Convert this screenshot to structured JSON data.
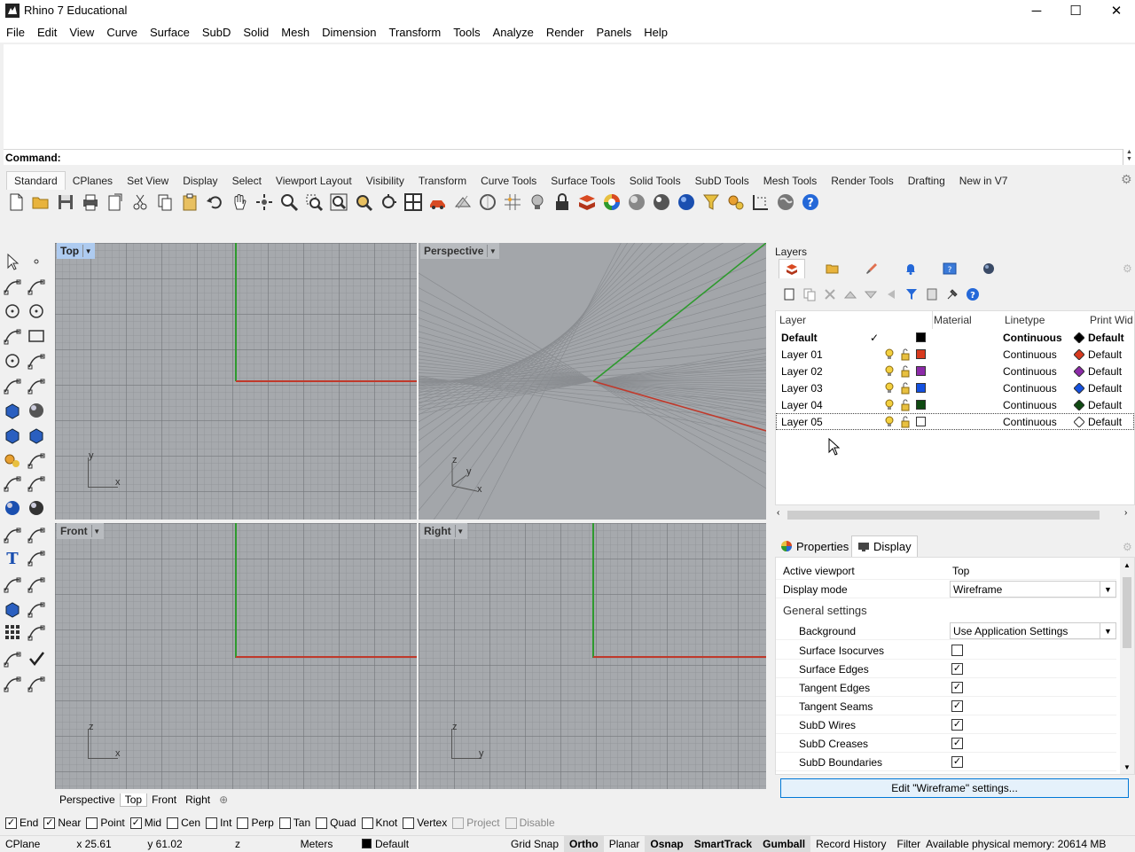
{
  "window": {
    "title": "Rhino 7 Educational",
    "minimize": "─",
    "maximize": "☐",
    "close": "✕"
  },
  "menu": [
    "File",
    "Edit",
    "View",
    "Curve",
    "Surface",
    "SubD",
    "Solid",
    "Mesh",
    "Dimension",
    "Transform",
    "Tools",
    "Analyze",
    "Render",
    "Panels",
    "Help"
  ],
  "command": {
    "label": "Command:",
    "value": ""
  },
  "toolbar_tabs": [
    "Standard",
    "CPlanes",
    "Set View",
    "Display",
    "Select",
    "Viewport Layout",
    "Visibility",
    "Transform",
    "Curve Tools",
    "Surface Tools",
    "Solid Tools",
    "SubD Tools",
    "Mesh Tools",
    "Render Tools",
    "Drafting",
    "New in V7"
  ],
  "toolbar_icons": [
    "new-icon",
    "open-icon",
    "save-icon",
    "print-icon",
    "import-icon",
    "cut-icon",
    "copy-icon",
    "paste-icon",
    "undo-icon",
    "pan-icon",
    "rotate-view-icon",
    "zoom-icon",
    "zoom-window-icon",
    "zoom-extents-icon",
    "zoom-selected-icon",
    "rotate-icon",
    "four-viewports-icon",
    "car-icon",
    "snap-icon",
    "circle-icon",
    "grid-icon",
    "light-icon",
    "lock-icon",
    "layer-icon",
    "color-wheel-icon",
    "shaded-sphere-icon",
    "rendered-sphere-icon",
    "blue-sphere-icon",
    "filter-icon",
    "settings-gears-icon",
    "dimension-icon",
    "earth-icon",
    "help-icon"
  ],
  "viewports": {
    "top": {
      "title": "Top",
      "x": "x",
      "y": "y"
    },
    "perspective": {
      "title": "Perspective",
      "x": "x",
      "y": "y",
      "z": "z"
    },
    "front": {
      "title": "Front",
      "x": "x",
      "z": "z"
    },
    "right": {
      "title": "Right",
      "y": "y",
      "z": "z"
    }
  },
  "viewport_tabs": [
    "Perspective",
    "Top",
    "Front",
    "Right"
  ],
  "viewport_tab_add": "⊕",
  "osnaps": [
    {
      "label": "End",
      "checked": true
    },
    {
      "label": "Near",
      "checked": true
    },
    {
      "label": "Point",
      "checked": false
    },
    {
      "label": "Mid",
      "checked": true
    },
    {
      "label": "Cen",
      "checked": false
    },
    {
      "label": "Int",
      "checked": false
    },
    {
      "label": "Perp",
      "checked": false
    },
    {
      "label": "Tan",
      "checked": false
    },
    {
      "label": "Quad",
      "checked": false
    },
    {
      "label": "Knot",
      "checked": false
    },
    {
      "label": "Vertex",
      "checked": false
    },
    {
      "label": "Project",
      "checked": false
    },
    {
      "label": "Disable",
      "checked": false
    }
  ],
  "status": {
    "cplane": "CPlane",
    "x": "x 25.61",
    "y": "y 61.02",
    "z": "z",
    "units": "Meters",
    "layer": "Default",
    "grid_snap": "Grid Snap",
    "ortho": "Ortho",
    "planar": "Planar",
    "osnap": "Osnap",
    "smarttrack": "SmartTrack",
    "gumball": "Gumball",
    "record_history": "Record History",
    "filter": "Filter",
    "memory": "Available physical memory: 20614 MB"
  },
  "layers": {
    "title": "Layers",
    "columns": {
      "layer": "Layer",
      "material": "Material",
      "linetype": "Linetype",
      "print_width": "Print Wid"
    },
    "rows": [
      {
        "name": "Default",
        "current": true,
        "check": "✓",
        "color": "#000000",
        "linetype": "Continuous",
        "print_color": "#000000",
        "print_width": "Default"
      },
      {
        "name": "Layer 01",
        "current": false,
        "check": "",
        "color": "#d83a1e",
        "linetype": "Continuous",
        "print_color": "#d83a1e",
        "print_width": "Default"
      },
      {
        "name": "Layer 02",
        "current": false,
        "check": "",
        "color": "#8c2aa8",
        "linetype": "Continuous",
        "print_color": "#8c2aa8",
        "print_width": "Default"
      },
      {
        "name": "Layer 03",
        "current": false,
        "check": "",
        "color": "#1451e0",
        "linetype": "Continuous",
        "print_color": "#1451e0",
        "print_width": "Default"
      },
      {
        "name": "Layer 04",
        "current": false,
        "check": "",
        "color": "#0f4a12",
        "linetype": "Continuous",
        "print_color": "#0f4a12",
        "print_width": "Default"
      },
      {
        "name": "Layer 05",
        "current": false,
        "check": "",
        "color": "#ffffff",
        "linetype": "Continuous",
        "print_color": "#ffffff",
        "print_width": "Default"
      }
    ]
  },
  "properties": {
    "tabs": [
      "Properties",
      "Display"
    ],
    "active_viewport_label": "Active viewport",
    "active_viewport_value": "Top",
    "display_mode_label": "Display mode",
    "display_mode_value": "Wireframe",
    "general_settings": "General settings",
    "background_label": "Background",
    "background_value": "Use Application Settings",
    "settings": [
      {
        "label": "Surface Isocurves",
        "checked": false
      },
      {
        "label": "Surface Edges",
        "checked": true
      },
      {
        "label": "Tangent Edges",
        "checked": true
      },
      {
        "label": "Tangent Seams",
        "checked": true
      },
      {
        "label": "SubD Wires",
        "checked": true
      },
      {
        "label": "SubD Creases",
        "checked": true
      },
      {
        "label": "SubD Boundaries",
        "checked": true
      }
    ],
    "edit_button": "Edit \"Wireframe\" settings..."
  },
  "colors": {
    "x_axis": "#c0392b",
    "y_axis": "#2e9a2e",
    "viewport_bg": "#a6a9ad",
    "active_title": "#aecbf0"
  }
}
